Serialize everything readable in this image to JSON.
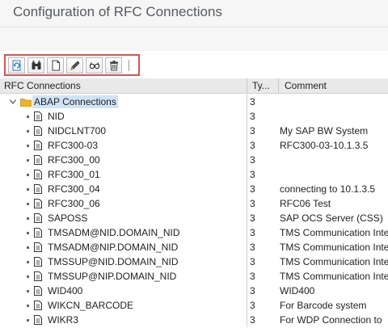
{
  "window": {
    "title": "Configuration of RFC Connections"
  },
  "toolbar": {
    "buttons": [
      {
        "name": "refresh-button",
        "icon": "refresh-icon"
      },
      {
        "name": "find-button",
        "icon": "binoculars-icon"
      },
      {
        "name": "create-button",
        "icon": "new-document-icon"
      },
      {
        "name": "change-button",
        "icon": "pencil-icon"
      },
      {
        "name": "display-button",
        "icon": "glasses-icon"
      },
      {
        "name": "delete-button",
        "icon": "trash-icon"
      }
    ]
  },
  "grid": {
    "columns": {
      "name": "RFC Connections",
      "type": "Ty...",
      "comment": "Comment"
    },
    "root": {
      "label": "ABAP Connections",
      "type": "3",
      "comment": "",
      "expanded": true
    },
    "items": [
      {
        "name": "NID",
        "type": "3",
        "comment": ""
      },
      {
        "name": "NIDCLNT700",
        "type": "3",
        "comment": "My SAP BW System"
      },
      {
        "name": "RFC300-03",
        "type": "3",
        "comment": "RFC300-03-10.1.3.5"
      },
      {
        "name": "RFC300_00",
        "type": "3",
        "comment": ""
      },
      {
        "name": "RFC300_01",
        "type": "3",
        "comment": ""
      },
      {
        "name": "RFC300_04",
        "type": "3",
        "comment": "connecting to 10.1.3.5"
      },
      {
        "name": "RFC300_06",
        "type": "3",
        "comment": "RFC06 Test"
      },
      {
        "name": "SAPOSS",
        "type": "3",
        "comment": "SAP OCS Server (CSS)"
      },
      {
        "name": "TMSADM@NID.DOMAIN_NID",
        "type": "3",
        "comment": "TMS Communication Inte"
      },
      {
        "name": "TMSADM@NIP.DOMAIN_NID",
        "type": "3",
        "comment": "TMS Communication Inte"
      },
      {
        "name": "TMSSUP@NID.DOMAIN_NID",
        "type": "3",
        "comment": "TMS Communication Inte"
      },
      {
        "name": "TMSSUP@NIP.DOMAIN_NID",
        "type": "3",
        "comment": "TMS Communication Inte"
      },
      {
        "name": "WID400",
        "type": "3",
        "comment": "WID400"
      },
      {
        "name": "WIKCN_BARCODE",
        "type": "3",
        "comment": "For Barcode system"
      },
      {
        "name": "WIKR3",
        "type": "3",
        "comment": "For WDP Connection to"
      }
    ]
  },
  "colors": {
    "toolbar_highlight": "#d9534f",
    "selection": "#cfe4f7",
    "folder": "#f0b323",
    "header_bg": "#e9e9e9"
  }
}
